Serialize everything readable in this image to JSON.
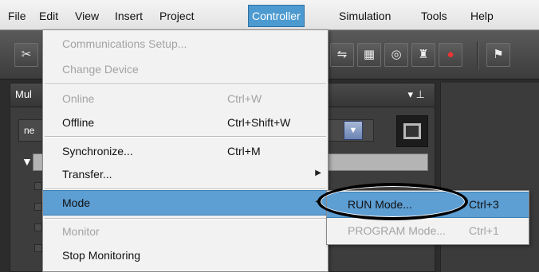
{
  "menubar": {
    "items": [
      "File",
      "Edit",
      "View",
      "Insert",
      "Project",
      "Controller",
      "Simulation",
      "Tools",
      "Help"
    ],
    "active": "Controller"
  },
  "toolbar": {
    "icons": [
      "cut-icon",
      "compare-icon",
      "cross-reference-icon",
      "watch-icon",
      "search-icon",
      "error-icon",
      "simulation-icon"
    ]
  },
  "panel": {
    "title": "Mul",
    "combo_value": "ne",
    "pin_glyph": "▾ ⊥"
  },
  "menu": {
    "items": [
      {
        "label": "Communications Setup...",
        "shortcut": "",
        "disabled": true
      },
      {
        "label": "Change Device",
        "shortcut": "",
        "disabled": true
      },
      {
        "label": "Online",
        "shortcut": "Ctrl+W",
        "disabled": true
      },
      {
        "label": "Offline",
        "shortcut": "Ctrl+Shift+W",
        "disabled": false
      },
      {
        "label": "Synchronize...",
        "shortcut": "Ctrl+M",
        "disabled": false
      },
      {
        "label": "Transfer...",
        "shortcut": "",
        "disabled": false,
        "submenu": true
      },
      {
        "label": "Mode",
        "shortcut": "",
        "disabled": false,
        "submenu": true,
        "selected": true
      },
      {
        "label": "Monitor",
        "shortcut": "",
        "disabled": true
      },
      {
        "label": "Stop Monitoring",
        "shortcut": "",
        "disabled": false
      }
    ]
  },
  "submenu": {
    "items": [
      {
        "label": "RUN Mode...",
        "shortcut": "Ctrl+3",
        "disabled": false,
        "selected": true
      },
      {
        "label": "PROGRAM Mode...",
        "shortcut": "Ctrl+1",
        "disabled": true
      }
    ]
  },
  "colors": {
    "menu_highlight": "#5d9ed3",
    "menu_background": "#f2f2f2",
    "disabled_text": "#a3a3a3",
    "workspace": "#2c2c2c"
  }
}
